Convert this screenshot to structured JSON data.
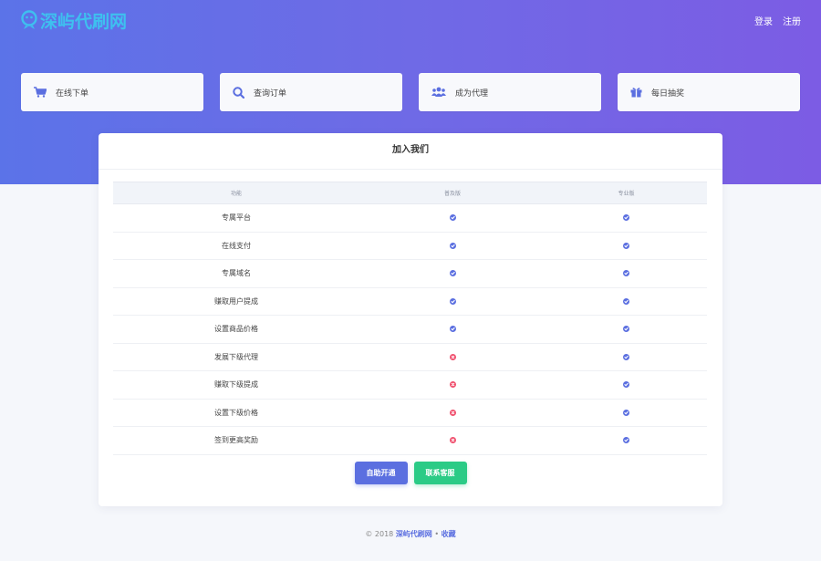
{
  "brand": {
    "name": "深屿代刷网",
    "color": "#3ec0ef"
  },
  "header": {
    "login_label": "登录",
    "register_label": "注册",
    "gradient": [
      "#5b73e8",
      "#7c5ce4"
    ]
  },
  "nav_cards": [
    {
      "label": "在线下单",
      "icon": "cart-icon"
    },
    {
      "label": "查询订单",
      "icon": "search-icon"
    },
    {
      "label": "成为代理",
      "icon": "users-icon"
    },
    {
      "label": "每日抽奖",
      "icon": "gift-icon"
    }
  ],
  "panel": {
    "title": "加入我们",
    "columns": [
      "功能",
      "普及版",
      "专业版"
    ],
    "rows": [
      {
        "feature": "专属平台",
        "basic": "check",
        "pro": "check"
      },
      {
        "feature": "在线支付",
        "basic": "check",
        "pro": "check"
      },
      {
        "feature": "专属域名",
        "basic": "check",
        "pro": "check"
      },
      {
        "feature": "赚取用户提成",
        "basic": "check",
        "pro": "check"
      },
      {
        "feature": "设置商品价格",
        "basic": "check",
        "pro": "check"
      },
      {
        "feature": "发展下级代理",
        "basic": "cross",
        "pro": "check"
      },
      {
        "feature": "赚取下级提成",
        "basic": "cross",
        "pro": "check"
      },
      {
        "feature": "设置下级价格",
        "basic": "cross",
        "pro": "check"
      },
      {
        "feature": "签到更高奖励",
        "basic": "cross",
        "pro": "check"
      }
    ],
    "buttons": {
      "self_open": "自助开通",
      "contact": "联系客服"
    },
    "colors": {
      "check": "#5b6fe0",
      "cross": "#f0506e"
    }
  },
  "footer": {
    "copyright": "© 2018",
    "site_link": "深屿代刷网",
    "separator": "•",
    "favorite_link": "收藏"
  }
}
